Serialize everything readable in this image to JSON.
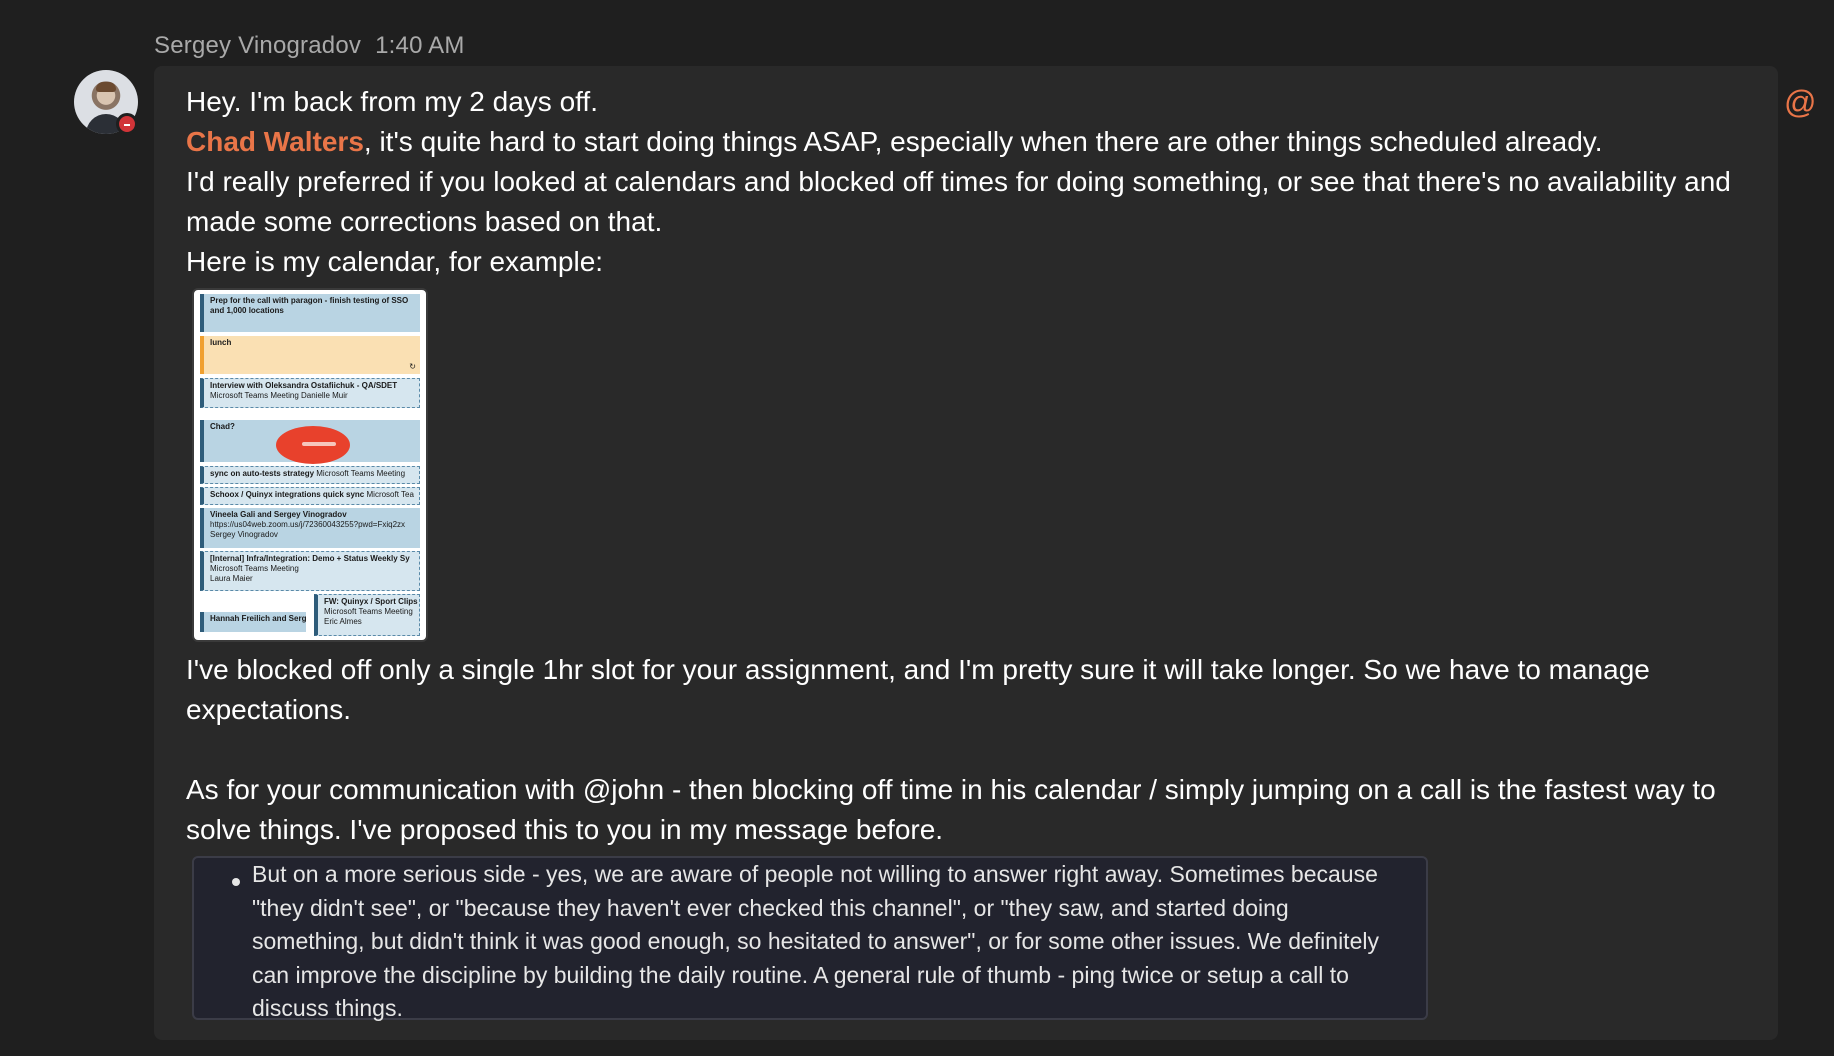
{
  "message": {
    "author": "Sergey Vinogradov",
    "time": "1:40 AM",
    "line1": "Hey. I'm back from my 2 days off.",
    "mention": "Chad Walters",
    "line2_rest": ", it's quite hard to start doing things ASAP, especially when there are other things scheduled already.",
    "line3": "I'd really preferred if you looked at calendars and blocked off times for doing something, or see that there's no availability and made some corrections based on that.",
    "line4": "Here is my calendar, for example:",
    "after_image": "I've blocked off only a single 1hr slot for your assignment, and I'm pretty sure it will take longer. So we have to manage expectations.",
    "paragraph2": "As for your communication with @john - then blocking off time in his calendar / simply jumping on a call is the fastest way to solve things. I've proposed this to you in my message before.",
    "quote": "But on a more serious side - yes, we are aware of people not willing to answer right away. Sometimes because \"they didn't see\", or \"because they haven't ever checked this channel\", or \"they saw, and started doing something, but didn't think it was good enough, so hesitated to answer\", or for some other issues. We definitely can improve the discipline by building the daily routine. A general rule of thumb - ping twice or setup a call to discuss things."
  },
  "calendar_thumb": {
    "events": [
      {
        "title": "Prep for the call with paragon - finish testing of SSO and 1,000 locations",
        "sub": ""
      },
      {
        "title": "lunch",
        "sub": ""
      },
      {
        "title": "Interview with Oleksandra Ostafiichuk - QA/SDET",
        "sub": "Microsoft Teams Meeting Danielle Muir"
      },
      {
        "title": "Chad?",
        "sub": ""
      },
      {
        "title": "sync on auto-tests strategy",
        "sub": "Microsoft Teams Meeting"
      },
      {
        "title": "Schoox / Quinyx integrations quick sync",
        "sub": "Microsoft Tea"
      },
      {
        "title": "Vineela Gali and Sergey Vinogradov",
        "sub": "https://us04web.zoom.us/j/72360043255?pwd=Fxiq2zx",
        "sub2": "Sergey Vinogradov"
      },
      {
        "title": "[Internal] Infra/Integration: Demo + Status Weekly Sy",
        "sub": "Microsoft Teams Meeting",
        "sub2": "Laura Maier"
      },
      {
        "title": "FW: Quinyx / Sport Clips",
        "sub": "Microsoft Teams Meeting",
        "sub2": "Eric Almes"
      },
      {
        "title": "Hannah Freilich and Sergi",
        "sub": ""
      }
    ]
  },
  "icons": {
    "mention_indicator": "@"
  },
  "colors": {
    "background": "#1f1f1f",
    "bubble": "#292929",
    "mention": "#e97548",
    "presence_busy": "#d13438"
  }
}
